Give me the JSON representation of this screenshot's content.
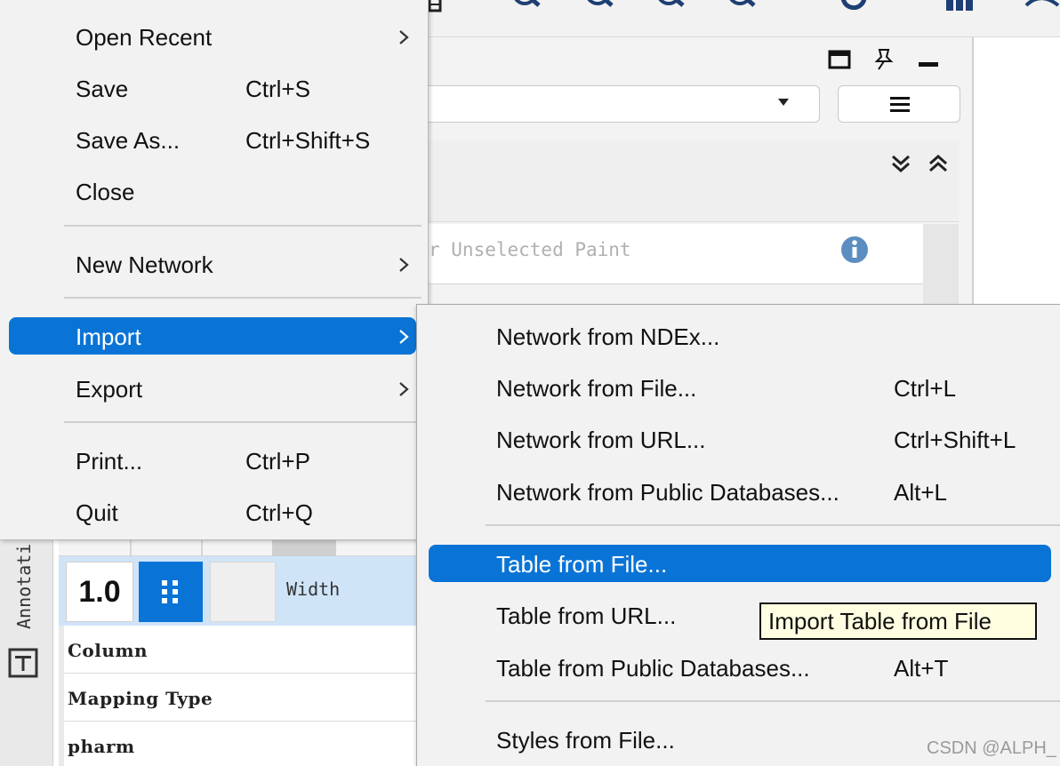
{
  "file_menu": {
    "items": [
      {
        "label": "Open Recent",
        "shortcut": "",
        "has_submenu": true
      },
      {
        "label": "Save",
        "shortcut": "Ctrl+S",
        "has_submenu": false
      },
      {
        "label": "Save As...",
        "shortcut": "Ctrl+Shift+S",
        "has_submenu": false
      },
      {
        "label": "Close",
        "shortcut": "",
        "has_submenu": false
      },
      {
        "label": "New Network",
        "shortcut": "",
        "has_submenu": true
      },
      {
        "label": "Import",
        "shortcut": "",
        "has_submenu": true,
        "highlighted": true
      },
      {
        "label": "Export",
        "shortcut": "",
        "has_submenu": true
      },
      {
        "label": "Print...",
        "shortcut": "Ctrl+P",
        "has_submenu": false
      },
      {
        "label": "Quit",
        "shortcut": "Ctrl+Q",
        "has_submenu": false
      }
    ]
  },
  "import_submenu": {
    "items": [
      {
        "label": "Network from NDEx...",
        "shortcut": ""
      },
      {
        "label": "Network from File...",
        "shortcut": "Ctrl+L"
      },
      {
        "label": "Network from URL...",
        "shortcut": "Ctrl+Shift+L"
      },
      {
        "label": "Network from Public Databases...",
        "shortcut": "Alt+L"
      },
      {
        "label": "Table from File...",
        "shortcut": "",
        "highlighted": true
      },
      {
        "label": "Table from URL...",
        "shortcut": ""
      },
      {
        "label": "Table from Public Databases...",
        "shortcut": "Alt+T"
      },
      {
        "label": "Styles from File...",
        "shortcut": ""
      }
    ]
  },
  "tooltip": {
    "text": "Import Table from File"
  },
  "background": {
    "unselected_paint_label": "r Unselected Paint",
    "annotation_tab_label": "Annotati",
    "width_property": {
      "value": "1.0",
      "label": "Width"
    },
    "property_rows": [
      "Column",
      "Mapping Type",
      "pharm"
    ]
  },
  "watermark": "CSDN @ALPH_",
  "colors": {
    "highlight": "#0a74d6",
    "menu_bg": "#f2f2f2",
    "tooltip_bg": "#fffee1"
  }
}
